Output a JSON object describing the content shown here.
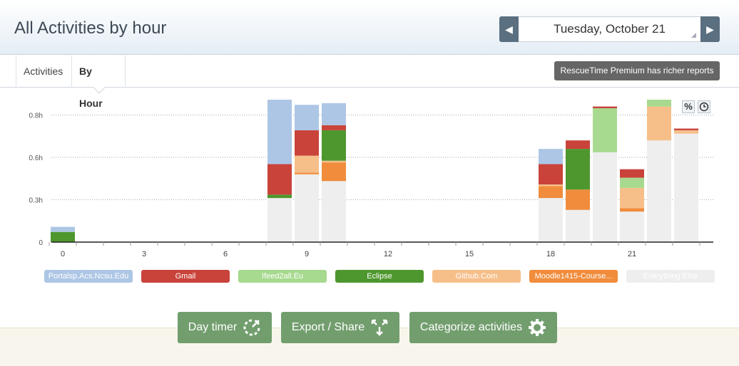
{
  "header": {
    "title": "All Activities by hour"
  },
  "date_nav": {
    "prev_arrow": "◀",
    "next_arrow": "▶",
    "date": "Tuesday, October 21"
  },
  "tabs": [
    {
      "label": "Activities"
    },
    {
      "label": "By Hour"
    }
  ],
  "premium_badge": "RescueTime Premium has richer reports",
  "mode_buttons": {
    "percent": "%"
  },
  "chart_data": {
    "type": "bar",
    "stacked": true,
    "x": [
      0,
      8,
      9,
      10,
      18,
      19,
      20,
      21,
      22,
      23
    ],
    "xticks": [
      "0",
      "3",
      "6",
      "9",
      "12",
      "15",
      "18",
      "21"
    ],
    "yticks": [
      "0",
      "0.3h",
      "0.6h",
      "0.8h"
    ],
    "ylim": [
      0,
      0.9
    ],
    "grid": true,
    "legend_position": "bottom",
    "series": [
      {
        "name": "Everything Else",
        "color": "#eeeeee",
        "values": [
          0.0,
          0.26,
          0.4,
          0.36,
          0.26,
          0.19,
          0.53,
          0.18,
          0.6,
          0.64
        ]
      },
      {
        "name": "Moodle1415-Course...",
        "color": "#f08c3c",
        "values": [
          0.0,
          0.0,
          0.01,
          0.11,
          0.07,
          0.12,
          0.0,
          0.02,
          0.0,
          0.0
        ]
      },
      {
        "name": "Github.Com",
        "color": "#f6bf8a",
        "values": [
          0.0,
          0.0,
          0.1,
          0.01,
          0.01,
          0.0,
          0.0,
          0.12,
          0.2,
          0.02
        ]
      },
      {
        "name": "Eclipse",
        "color": "#4e972e",
        "values": [
          0.06,
          0.02,
          0.0,
          0.18,
          0.0,
          0.24,
          0.0,
          0.0,
          0.0,
          0.0
        ]
      },
      {
        "name": "Ifeed2all.Eu",
        "color": "#a7d98e",
        "values": [
          0.0,
          0.0,
          0.0,
          0.0,
          0.0,
          0.0,
          0.26,
          0.06,
          0.11,
          0.0
        ]
      },
      {
        "name": "Gmail",
        "color": "#c9433a",
        "values": [
          0.0,
          0.18,
          0.15,
          0.03,
          0.12,
          0.05,
          0.01,
          0.05,
          0.01,
          0.01
        ]
      },
      {
        "name": "Portalsp.Acs.Ncsu.Edu",
        "color": "#adc6e5",
        "values": [
          0.03,
          0.42,
          0.15,
          0.13,
          0.09,
          0.0,
          0.0,
          0.0,
          0.0,
          0.0
        ]
      }
    ]
  },
  "legend": [
    {
      "label": "Portalsp.Acs.Ncsu.Edu",
      "color": "#adc6e5"
    },
    {
      "label": "Gmail",
      "color": "#c9433a"
    },
    {
      "label": "Ifeed2all.Eu",
      "color": "#a7d98e"
    },
    {
      "label": "Eclipse",
      "color": "#4e972e"
    },
    {
      "label": "Github.Com",
      "color": "#f6bf8a"
    },
    {
      "label": "Moodle1415-Course...",
      "color": "#f08c3c"
    },
    {
      "label": "Everything Else",
      "color": "#eeeeee"
    }
  ],
  "actions": {
    "day_timer": "Day timer",
    "export_share": "Export / Share",
    "categorize": "Categorize activities"
  }
}
